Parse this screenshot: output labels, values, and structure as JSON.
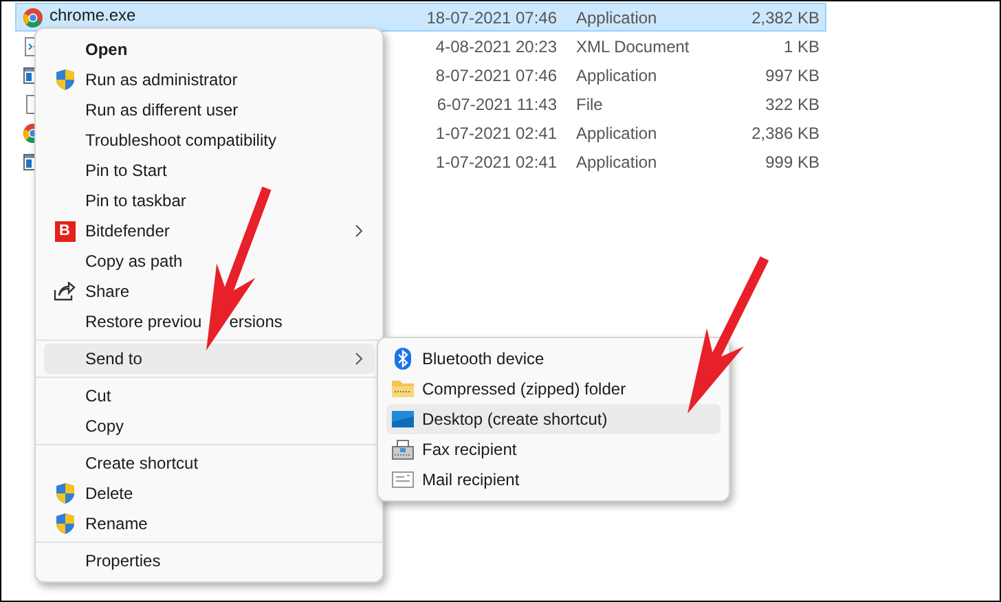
{
  "files": [
    {
      "name": "chrome.exe",
      "date": "18-07-2021 07:46",
      "type": "Application",
      "size": "2,382 KB",
      "kind": "chrome",
      "selected": true
    },
    {
      "date": "4-08-2021 20:23",
      "type": "XML Document",
      "size": "1 KB",
      "kind": "xml",
      "selected": false
    },
    {
      "date": "8-07-2021 07:46",
      "type": "Application",
      "size": "997 KB",
      "kind": "app",
      "selected": false
    },
    {
      "date": "6-07-2021 11:43",
      "type": "File",
      "size": "322 KB",
      "kind": "file",
      "selected": false
    },
    {
      "date": "1-07-2021 02:41",
      "type": "Application",
      "size": "2,386 KB",
      "kind": "chrome",
      "selected": false
    },
    {
      "date": "1-07-2021 02:41",
      "type": "Application",
      "size": "999 KB",
      "kind": "app",
      "selected": false
    }
  ],
  "context_menu": {
    "groups": [
      [
        {
          "label": "Open",
          "bold": true,
          "selected": false
        },
        {
          "label": "Run as administrator",
          "kind": "shield",
          "selected": false
        },
        {
          "label": "Run as different user",
          "selected": false
        },
        {
          "label": "Troubleshoot compatibility",
          "selected": false
        },
        {
          "label": "Pin to Start",
          "selected": false
        },
        {
          "label": "Pin to taskbar",
          "selected": false
        },
        {
          "label": "Bitdefender",
          "kind": "bitdefender",
          "logo_text": "B",
          "submenu": true,
          "selected": false
        },
        {
          "label": "Copy as path",
          "selected": false
        },
        {
          "label": "Share",
          "kind": "share",
          "selected": false
        },
        {
          "label": "Restore previou",
          "label_tail": "ersions",
          "selected": false
        }
      ],
      [
        {
          "label": "Send to",
          "submenu": true,
          "selected": true
        }
      ],
      [
        {
          "label": "Cut",
          "selected": false
        },
        {
          "label": "Copy",
          "selected": false
        }
      ],
      [
        {
          "label": "Create shortcut",
          "selected": false
        },
        {
          "label": "Delete",
          "kind": "shield",
          "selected": false
        },
        {
          "label": "Rename",
          "kind": "shield",
          "selected": false
        }
      ],
      [
        {
          "label": "Properties",
          "selected": false
        }
      ]
    ]
  },
  "send_to_menu": [
    {
      "label": "Bluetooth device",
      "kind": "bluetooth",
      "selected": false
    },
    {
      "label": "Compressed (zipped) folder",
      "kind": "zip",
      "selected": false
    },
    {
      "label": "Desktop (create shortcut)",
      "kind": "desktop",
      "selected": true
    },
    {
      "label": "Fax recipient",
      "kind": "fax",
      "selected": false
    },
    {
      "label": "Mail recipient",
      "kind": "mail",
      "selected": false
    }
  ]
}
